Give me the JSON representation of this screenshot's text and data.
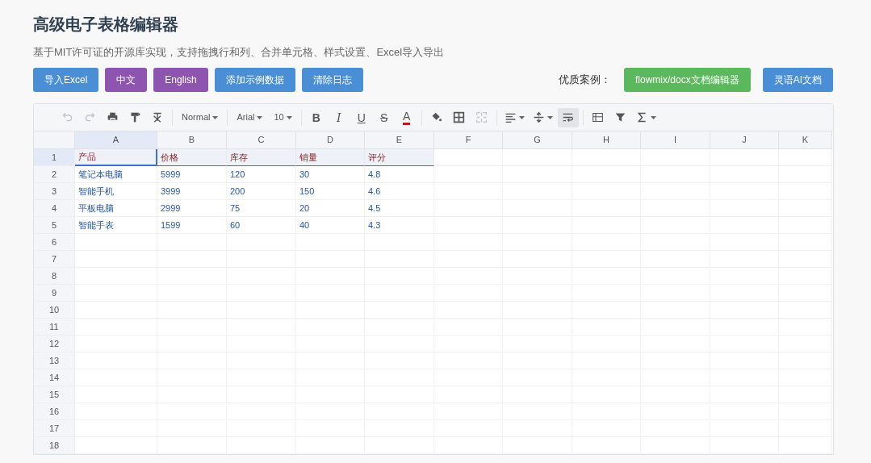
{
  "title": "高级电子表格编辑器",
  "subtitle": "基于MIT许可证的开源库实现，支持拖拽行和列、合并单元格、样式设置、Excel导入导出",
  "buttons": [
    {
      "label": "导入Excel",
      "color": "#4a8fd6"
    },
    {
      "label": "中文",
      "color": "#8e55b0"
    },
    {
      "label": "English",
      "color": "#8e55b0"
    },
    {
      "label": "添加示例数据",
      "color": "#4a8fd6"
    },
    {
      "label": "清除日志",
      "color": "#4a8fd6"
    }
  ],
  "showcase": {
    "label": "优质案例：",
    "links": [
      {
        "label": "flowmix/docx文档编辑器",
        "color": "#5cb85c"
      },
      {
        "label": "灵语AI文档",
        "color": "#4a8fd6"
      }
    ]
  },
  "toolbar": [
    {
      "kind": "undo",
      "disabled": true,
      "active": false
    },
    {
      "kind": "redo",
      "disabled": true,
      "active": false
    },
    {
      "kind": "print",
      "disabled": false,
      "active": false
    },
    {
      "kind": "paint",
      "disabled": false,
      "active": false
    },
    {
      "kind": "clear",
      "disabled": false,
      "active": false
    },
    {
      "kind": "separator"
    },
    {
      "kind": "dropdown",
      "label": "Normal",
      "disabled": false,
      "active": false
    },
    {
      "kind": "separator"
    },
    {
      "kind": "dropdown",
      "label": "Arial",
      "disabled": false,
      "active": false
    },
    {
      "kind": "dropdown",
      "label": "10",
      "disabled": false,
      "active": false
    },
    {
      "kind": "separator"
    },
    {
      "kind": "letter",
      "label": "B",
      "disabled": false,
      "active": false
    },
    {
      "kind": "letter",
      "label": "I",
      "disabled": false,
      "active": false
    },
    {
      "kind": "letter",
      "label": "U",
      "disabled": false,
      "active": false
    },
    {
      "kind": "letter",
      "label": "S",
      "disabled": false,
      "active": false
    },
    {
      "kind": "letter",
      "label": "A",
      "color": "#b01e1e",
      "disabled": false,
      "active": false
    },
    {
      "kind": "separator"
    },
    {
      "kind": "fill",
      "disabled": false,
      "active": false
    },
    {
      "kind": "border",
      "disabled": false,
      "active": false
    },
    {
      "kind": "merge",
      "disabled": true,
      "active": false
    },
    {
      "kind": "separator"
    },
    {
      "kind": "align",
      "disabled": false,
      "active": false
    },
    {
      "kind": "valign",
      "disabled": false,
      "active": false
    },
    {
      "kind": "wrap",
      "disabled": false,
      "active": true
    },
    {
      "kind": "separator"
    },
    {
      "kind": "freeze",
      "disabled": false,
      "active": false
    },
    {
      "kind": "filter",
      "disabled": false,
      "active": false
    },
    {
      "kind": "sum",
      "disabled": false,
      "active": false
    }
  ],
  "columns": [
    {
      "label": "A",
      "selected": true
    },
    {
      "label": "B",
      "selected": false
    },
    {
      "label": "C",
      "selected": false
    },
    {
      "label": "D",
      "selected": false
    },
    {
      "label": "E",
      "selected": false
    },
    {
      "label": "F",
      "selected": false
    },
    {
      "label": "G",
      "selected": false
    },
    {
      "label": "H",
      "selected": false
    },
    {
      "label": "I",
      "selected": false
    },
    {
      "label": "J",
      "selected": false
    },
    {
      "label": "K",
      "selected": false
    }
  ],
  "rows": [
    {
      "label": "1",
      "selected": true,
      "kind": "header",
      "cells": [
        "产品",
        "价格",
        "库存",
        "销量",
        "评分"
      ]
    },
    {
      "label": "2",
      "selected": false,
      "kind": "data",
      "cells": [
        "笔记本电脑",
        "5999",
        "120",
        "30",
        "4.8"
      ]
    },
    {
      "label": "3",
      "selected": false,
      "kind": "data",
      "cells": [
        "智能手机",
        "3999",
        "200",
        "150",
        "4.6"
      ]
    },
    {
      "label": "4",
      "selected": false,
      "kind": "data",
      "cells": [
        "平板电脑",
        "2999",
        "75",
        "20",
        "4.5"
      ]
    },
    {
      "label": "5",
      "selected": false,
      "kind": "data",
      "cells": [
        "智能手表",
        "1599",
        "60",
        "40",
        "4.3"
      ]
    },
    {
      "label": "6",
      "selected": false
    },
    {
      "label": "7",
      "selected": false
    },
    {
      "label": "8",
      "selected": false
    },
    {
      "label": "9",
      "selected": false
    },
    {
      "label": "10",
      "selected": false
    },
    {
      "label": "11",
      "selected": false
    },
    {
      "label": "12",
      "selected": false
    },
    {
      "label": "13",
      "selected": false
    },
    {
      "label": "14",
      "selected": false
    },
    {
      "label": "15",
      "selected": false
    },
    {
      "label": "16",
      "selected": false
    },
    {
      "label": "17",
      "selected": false
    },
    {
      "label": "18",
      "selected": false
    }
  ]
}
